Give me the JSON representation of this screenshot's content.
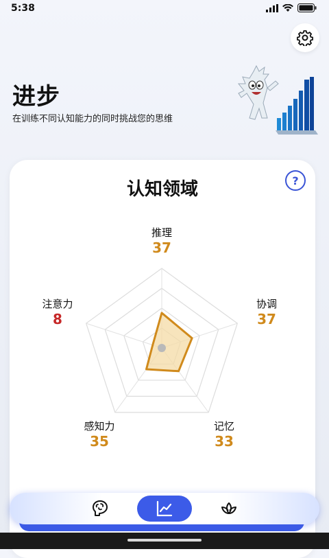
{
  "status": {
    "time": "5:38"
  },
  "header": {
    "title": "进步",
    "subtitle": "在训练不同认知能力的同时挑战您的思维"
  },
  "card": {
    "title": "认知领域",
    "help_label": "?"
  },
  "colors": {
    "accent": "#3c5be8",
    "value_gold": "#d08a1c",
    "value_red": "#c62828",
    "radar_fill": "#f4dba6",
    "radar_stroke": "#d08a1c"
  },
  "chart_data": {
    "type": "radar",
    "axes": [
      {
        "label": "推理",
        "value": 37
      },
      {
        "label": "协调",
        "value": 37
      },
      {
        "label": "记忆",
        "value": 33
      },
      {
        "label": "感知力",
        "value": 35
      },
      {
        "label": "注意力",
        "value": 8
      }
    ],
    "shape_fractions": [
      0.44,
      0.4,
      0.36,
      0.33,
      0.12
    ],
    "rings": 4,
    "grid": true
  },
  "nav": {
    "items": [
      {
        "icon": "brain-icon",
        "active": false
      },
      {
        "icon": "chart-line-icon",
        "active": true
      },
      {
        "icon": "lotus-icon",
        "active": false
      }
    ]
  }
}
